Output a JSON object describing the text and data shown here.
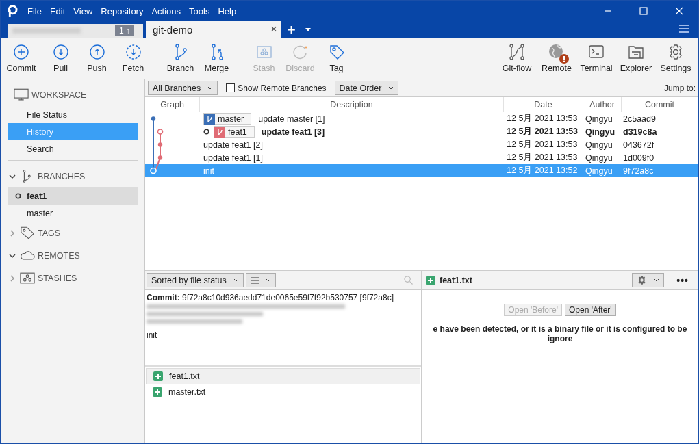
{
  "menu": [
    "File",
    "Edit",
    "View",
    "Repository",
    "Actions",
    "Tools",
    "Help"
  ],
  "tabs": [
    {
      "kind": "blurred",
      "badge": "1 ↑",
      "selected": false
    },
    {
      "kind": "named",
      "label": "git-demo",
      "close": "×",
      "selected": true
    }
  ],
  "new_tab": "+",
  "toolbar_left": [
    {
      "label": "Commit",
      "disabled": false
    },
    {
      "label": "Pull",
      "disabled": false
    },
    {
      "label": "Push",
      "disabled": false
    },
    {
      "label": "Fetch",
      "disabled": false
    },
    {
      "label": "Branch",
      "disabled": false
    },
    {
      "label": "Merge",
      "disabled": false
    },
    {
      "label": "Stash",
      "disabled": true
    },
    {
      "label": "Discard",
      "disabled": true
    },
    {
      "label": "Tag",
      "disabled": false
    }
  ],
  "toolbar_right": [
    {
      "label": "Git-flow"
    },
    {
      "label": "Remote",
      "alert": true
    },
    {
      "label": "Terminal"
    },
    {
      "label": "Explorer"
    },
    {
      "label": "Settings"
    }
  ],
  "sidebar": [
    {
      "title": "WORKSPACE",
      "items": [
        {
          "label": "File Status",
          "selected": false,
          "current": false
        },
        {
          "label": "History",
          "selected": true,
          "current": false
        },
        {
          "label": "Search",
          "selected": false,
          "current": false
        }
      ]
    },
    {
      "title": "BRANCHES",
      "expanded": true,
      "items": [
        {
          "label": "feat1",
          "selected": true,
          "current": true
        },
        {
          "label": "master",
          "selected": false,
          "current": false
        }
      ]
    },
    {
      "title": "TAGS",
      "expanded": false
    },
    {
      "title": "REMOTES",
      "expanded": true
    },
    {
      "title": "STASHES",
      "expanded": false
    }
  ],
  "filter_bar": {
    "branches": "All Branches",
    "show_remote": {
      "label": "Show Remote Branches",
      "checked": false
    },
    "order": "Date Order",
    "jump": "Jump to:"
  },
  "table": {
    "columns": [
      "Graph",
      "Description",
      "Date",
      "Author",
      "Commit"
    ],
    "rows": [
      {
        "refs": [
          {
            "name": "master",
            "color": "#3b6fb6"
          }
        ],
        "description": "update master [1]",
        "date": "12 5月 2021 13:53",
        "author": "Qingyu",
        "commit": "2c5aad9",
        "current": false,
        "selected": false
      },
      {
        "refs": [
          {
            "name": "feat1",
            "color": "#e06c75"
          }
        ],
        "description": "update feat1 [3]",
        "date": "12 5月 2021 13:53",
        "author": "Qingyu",
        "commit": "d319c8a",
        "current": true,
        "selected": false
      },
      {
        "refs": [],
        "description": "update feat1 [2]",
        "date": "12 5月 2021 13:53",
        "author": "Qingyu",
        "commit": "043672f",
        "current": false,
        "selected": false
      },
      {
        "refs": [],
        "description": "update feat1 [1]",
        "date": "12 5月 2021 13:53",
        "author": "Qingyu",
        "commit": "1d009f0",
        "current": false,
        "selected": false
      },
      {
        "refs": [],
        "description": "init",
        "date": "12 5月 2021 13:52",
        "author": "Qingyu",
        "commit": "9f72a8c",
        "current": false,
        "selected": true
      }
    ]
  },
  "file_panel": {
    "sort": "Sorted by file status",
    "commit_line": "**Commit:** 9f72a8c10d936aedd71de0065e59f7f92b530757 [9f72a8c]",
    "message": "init",
    "files": [
      {
        "name": "feat1.txt",
        "kind": "added",
        "selected": true
      },
      {
        "name": "master.txt",
        "kind": "added",
        "selected": false
      }
    ]
  },
  "diff_panel": {
    "file": "feat1.txt",
    "kind": "added",
    "more": "•••",
    "buttons": [
      {
        "label": "Open 'Before'",
        "disabled": true
      },
      {
        "label": "Open 'After'",
        "disabled": false
      }
    ],
    "notice": "e have been detected, or it is a binary file or it is configured to be ignore"
  }
}
